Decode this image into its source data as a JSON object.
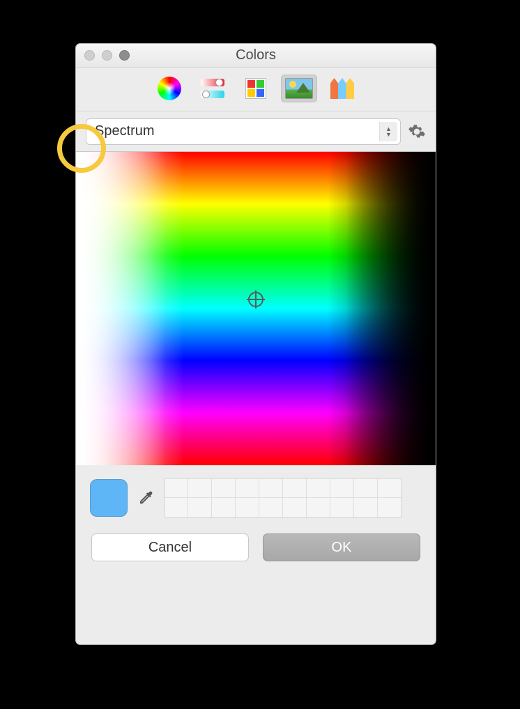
{
  "window": {
    "title": "Colors"
  },
  "modes": {
    "items": [
      "wheel",
      "sliders",
      "palette",
      "image",
      "crayons"
    ],
    "selected": "image"
  },
  "dropdown": {
    "value": "Spectrum"
  },
  "current_color": "#5fb6f6",
  "swatch_slots": 20,
  "buttons": {
    "cancel": "Cancel",
    "ok": "OK"
  }
}
